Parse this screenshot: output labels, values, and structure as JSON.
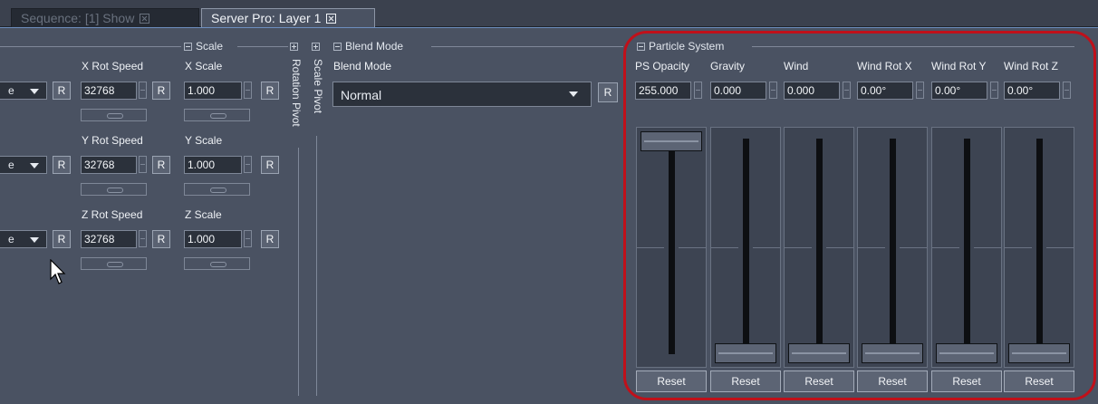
{
  "tabs": [
    {
      "label": "Sequence: [1] Show",
      "active": false
    },
    {
      "label": "Server Pro: Layer 1",
      "active": true
    }
  ],
  "left_dropdown_value": "e",
  "scale_group": {
    "title": "Scale",
    "rows": [
      {
        "rot_label": "X Rot Speed",
        "rot_value": "32768",
        "scale_label": "X Scale",
        "scale_value": "1.000"
      },
      {
        "rot_label": "Y Rot Speed",
        "rot_value": "32768",
        "scale_label": "Y Scale",
        "scale_value": "1.000"
      },
      {
        "rot_label": "Z Rot Speed",
        "rot_value": "32768",
        "scale_label": "Z Scale",
        "scale_value": "1.000"
      }
    ],
    "reset_label": "R"
  },
  "rotation_pivot_label": "Rotation Pivot",
  "scale_pivot_label": "Scale Pivot",
  "blend_group": {
    "title": "Blend Mode",
    "label": "Blend Mode",
    "value": "Normal",
    "reset_label": "R"
  },
  "particle_system": {
    "title": "Particle System",
    "reset_label": "Reset",
    "highlight_color": "#c0101a",
    "params": [
      {
        "label": "PS Opacity",
        "value": "255.000",
        "level": 1.0
      },
      {
        "label": "Gravity",
        "value": "0.000",
        "level": 0.0
      },
      {
        "label": "Wind",
        "value": "0.000",
        "level": 0.0
      },
      {
        "label": "Wind Rot X",
        "value": "0.00°",
        "level": 0.0
      },
      {
        "label": "Wind Rot Y",
        "value": "0.00°",
        "level": 0.0
      },
      {
        "label": "Wind Rot Z",
        "value": "0.00°",
        "level": 0.0
      }
    ]
  }
}
